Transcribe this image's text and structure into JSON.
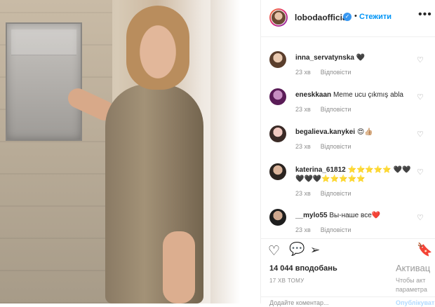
{
  "post": {
    "author": "lobodaofficial",
    "follow_label": "Стежити",
    "more_label": "•••",
    "likes": "14 044 вподобань",
    "time": "17 ХВ ТОМУ",
    "add_comment_placeholder": "Додайте коментар...",
    "publish_label": "Опублікувати"
  },
  "comments": [
    {
      "user": "inna_servatynska",
      "text": "🖤",
      "time": "23 хв",
      "reply": "Відповісти"
    },
    {
      "user": "eneskkaan",
      "text": "Meme ucu çıkmış abla",
      "time": "23 хв",
      "reply": "Відповісти"
    },
    {
      "user": "begalieva.kanykei",
      "text": "😍👍🏼",
      "time": "23 хв",
      "reply": "Відповісти"
    },
    {
      "user": "katerina_61812",
      "text": "⭐⭐⭐⭐⭐ 🖤🖤🖤🖤🖤⭐⭐⭐⭐⭐",
      "time": "23 хв",
      "reply": "Відповісти"
    },
    {
      "user": "__mylo55",
      "text": "Вы-наше все❤️",
      "time": "23 хв",
      "reply": "Відповісти"
    }
  ],
  "overlay": {
    "line1": "Активац",
    "line2": "Чтобы акт",
    "line3": "параметра"
  }
}
